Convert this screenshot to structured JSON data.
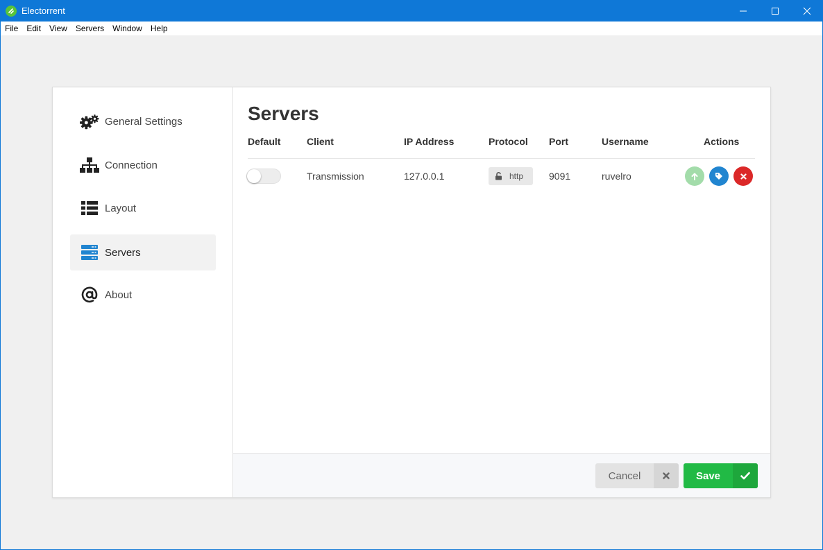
{
  "window": {
    "title": "Electorrent",
    "controls": [
      "minimize-icon",
      "maximize-icon",
      "close-icon"
    ]
  },
  "menu": [
    "File",
    "Edit",
    "View",
    "Servers",
    "Window",
    "Help"
  ],
  "sidebar": {
    "items": [
      {
        "label": "General Settings",
        "icon": "gears-icon",
        "active": false
      },
      {
        "label": "Connection",
        "icon": "sitemap-icon",
        "active": false
      },
      {
        "label": "Layout",
        "icon": "list-icon",
        "active": false
      },
      {
        "label": "Servers",
        "icon": "server-icon",
        "active": true
      },
      {
        "label": "About",
        "icon": "at-icon",
        "active": false
      }
    ]
  },
  "main": {
    "title": "Servers",
    "columns": [
      "Default",
      "Client",
      "IP Address",
      "Protocol",
      "Port",
      "Username",
      "Actions"
    ],
    "rows": [
      {
        "default": false,
        "client": "Transmission",
        "ip": "127.0.0.1",
        "protocol": "http",
        "protocol_icon": "unlock-icon",
        "port": "9091",
        "username": "ruvelro",
        "actions": [
          {
            "name": "connect",
            "icon": "arrow-up-icon",
            "color": "#a3dcaa"
          },
          {
            "name": "labels",
            "icon": "tag-icon",
            "color": "#2185d0"
          },
          {
            "name": "delete",
            "icon": "x-icon",
            "color": "#db2828"
          }
        ]
      }
    ]
  },
  "footer": {
    "cancel_label": "Cancel",
    "save_label": "Save"
  },
  "colors": {
    "titlebar": "#0f78d7",
    "save": "#21ba45",
    "active_icon": "#2185d0"
  }
}
